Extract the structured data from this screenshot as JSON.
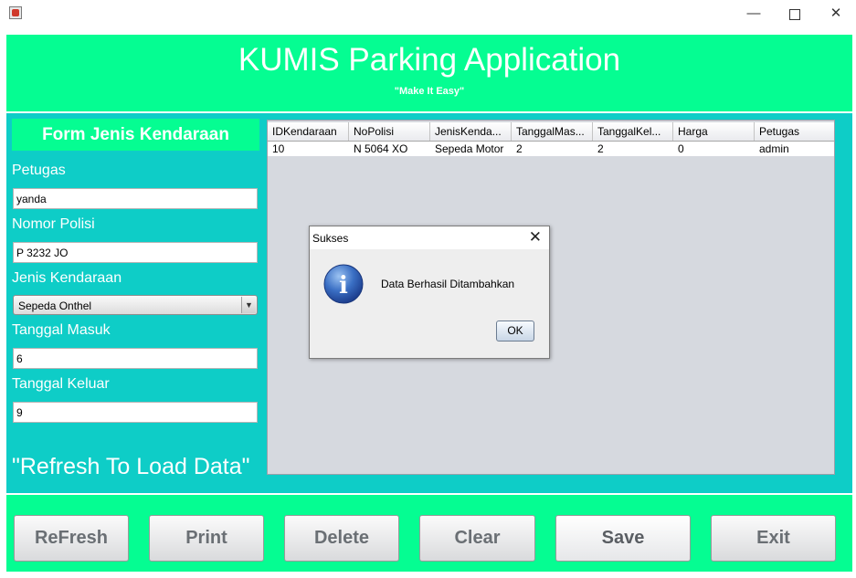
{
  "window": {
    "minimize": "—",
    "close": "✕"
  },
  "header": {
    "title": "KUMIS Parking Application",
    "subtitle": "\"Make It Easy\""
  },
  "form": {
    "title": "Form Jenis Kendaraan",
    "petugas_label": "Petugas",
    "petugas_value": "yanda",
    "nopol_label": "Nomor Polisi",
    "nopol_value": "P 3232 JO",
    "jenis_label": "Jenis Kendaraan",
    "jenis_value": "Sepeda Onthel",
    "masuk_label": "Tanggal Masuk",
    "masuk_value": "6",
    "keluar_label": "Tanggal Keluar",
    "keluar_value": "9",
    "refresh_hint": "\"Refresh To Load Data\""
  },
  "table": {
    "columns": [
      "IDKendaraan",
      "NoPolisi",
      "JenisKenda...",
      "TanggalMas...",
      "TanggalKel...",
      "Harga",
      "Petugas"
    ],
    "rows": [
      [
        "10",
        "N 5064 XO",
        "Sepeda Motor",
        "2",
        "2",
        "0",
        "admin"
      ]
    ]
  },
  "dialog": {
    "title": "Sukses",
    "close": "✕",
    "icon_letter": "i",
    "message": "Data Berhasil Ditambahkan",
    "ok": "OK"
  },
  "buttons": {
    "refresh": "ReFresh",
    "print": "Print",
    "delete": "Delete",
    "clear": "Clear",
    "save": "Save",
    "exit": "Exit"
  },
  "colors": {
    "header_green": "#05fd92",
    "panel_teal": "#0ecdc7",
    "table_bg": "#d6d9df"
  },
  "icons": {
    "app": "java-cup-icon",
    "dialog": "information-icon"
  }
}
